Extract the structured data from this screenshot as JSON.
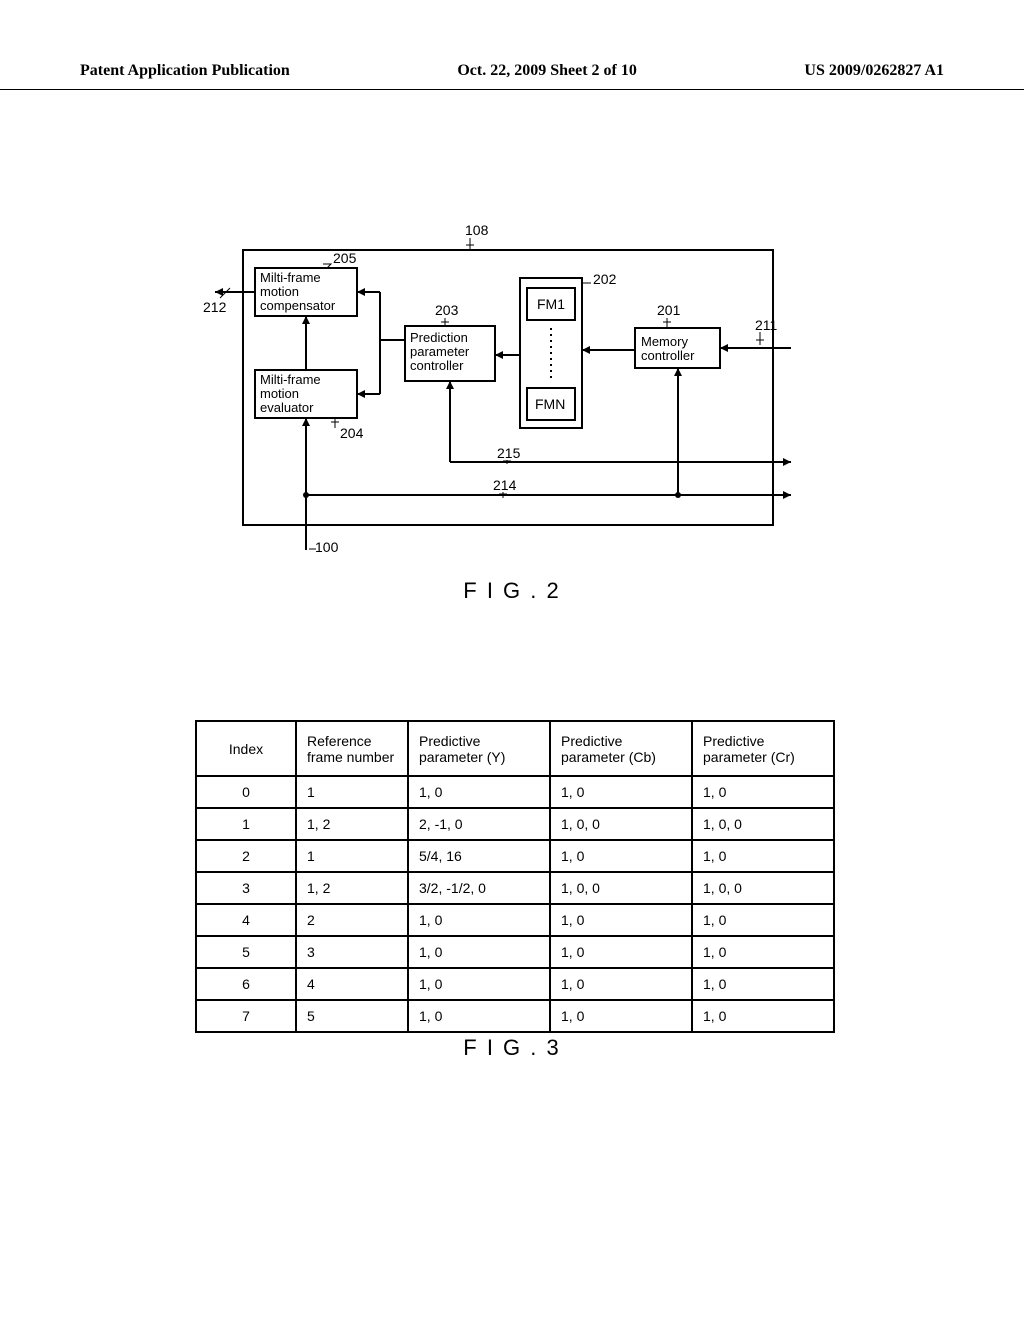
{
  "header": {
    "left": "Patent Application Publication",
    "center": "Oct. 22, 2009  Sheet 2 of 10",
    "right": "US 2009/0262827 A1"
  },
  "figure2": {
    "caption": "F I G . 2",
    "labels": {
      "top": "108",
      "box205": "205",
      "compensator": "Milti-frame motion compensator",
      "evaluator": "Milti-frame motion evaluator",
      "label212": "212",
      "label204": "204",
      "label203": "203",
      "predictionController": "Prediction parameter controller",
      "label202": "202",
      "fm1": "FM1",
      "fmn": "FMN",
      "label201": "201",
      "memoryController": "Memory controller",
      "label211": "211",
      "label215": "215",
      "label214": "214",
      "label100": "100"
    }
  },
  "figure3": {
    "caption": "F I G . 3",
    "headers": [
      "Index",
      "Reference frame number",
      "Predictive parameter (Y)",
      "Predictive parameter (Cb)",
      "Predictive parameter (Cr)"
    ],
    "rows": [
      [
        "0",
        "1",
        "1, 0",
        "1, 0",
        "1, 0"
      ],
      [
        "1",
        "1, 2",
        "2, -1, 0",
        "1, 0, 0",
        "1, 0, 0"
      ],
      [
        "2",
        "1",
        "5/4, 16",
        "1, 0",
        "1, 0"
      ],
      [
        "3",
        "1, 2",
        "3/2, -1/2, 0",
        "1, 0, 0",
        "1, 0, 0"
      ],
      [
        "4",
        "2",
        "1, 0",
        "1, 0",
        "1, 0"
      ],
      [
        "5",
        "3",
        "1, 0",
        "1, 0",
        "1, 0"
      ],
      [
        "6",
        "4",
        "1, 0",
        "1, 0",
        "1, 0"
      ],
      [
        "7",
        "5",
        "1, 0",
        "1, 0",
        "1, 0"
      ]
    ]
  }
}
